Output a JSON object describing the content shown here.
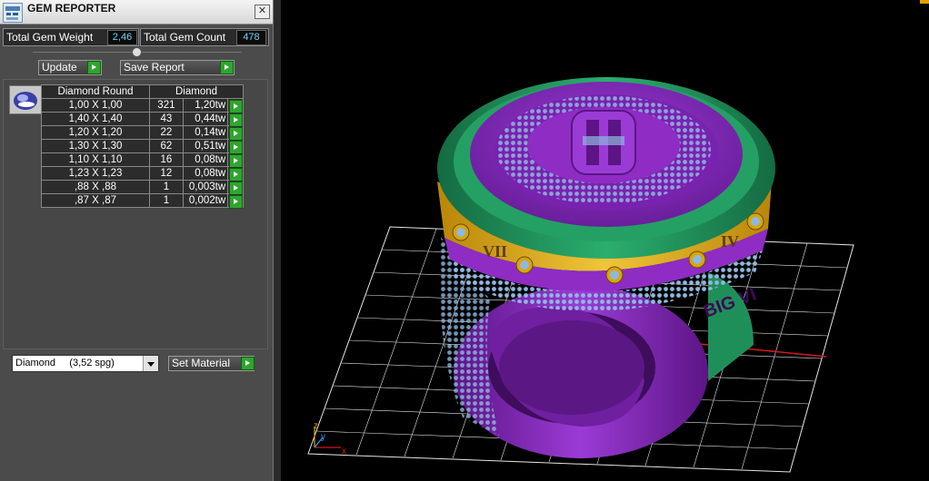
{
  "window": {
    "title": "GEM REPORTER",
    "close_glyph": "✕"
  },
  "stats": {
    "total_weight_label": "Total Gem Weight",
    "total_weight_value": "2,46",
    "total_count_label": "Total Gem Count",
    "total_count_value": "478"
  },
  "actions": {
    "update_label": "Update",
    "save_report_label": "Save Report"
  },
  "table": {
    "headers": [
      "Diamond Round",
      "Diamond"
    ],
    "rows": [
      {
        "size": "1,00 X 1,00",
        "count": "321",
        "weight": "1,20tw"
      },
      {
        "size": "1,40 X 1,40",
        "count": "43",
        "weight": "0,44tw"
      },
      {
        "size": "1,20 X 1,20",
        "count": "22",
        "weight": "0,14tw"
      },
      {
        "size": "1,30 X 1,30",
        "count": "62",
        "weight": "0,51tw"
      },
      {
        "size": "1,10 X 1,10",
        "count": "16",
        "weight": "0,08tw"
      },
      {
        "size": "1,23 X 1,23",
        "count": "12",
        "weight": "0,08tw"
      },
      {
        "size": ",88 X ,88",
        "count": "1",
        "weight": "0,003tw"
      },
      {
        "size": ",87 X ,87",
        "count": "1",
        "weight": "0,002tw"
      }
    ]
  },
  "material": {
    "selected": "Diamond     (3,52 spg)",
    "set_label": "Set Material"
  },
  "viewport": {
    "axis_labels": {
      "x": "x",
      "y": "y",
      "z": "z"
    },
    "ring_text": {
      "numeral_left": "VII",
      "numeral_right": "IV",
      "side_text": "BIG VI"
    },
    "colors": {
      "band": "#7a22b0",
      "top": "#8e2cc4",
      "green": "#1f8f5a",
      "gold": "#d9a50c",
      "gems": "#8fb8e0",
      "grid": "#ffffff"
    }
  },
  "icons": [
    "app-icon",
    "close-icon",
    "collapse-icon",
    "play-icon",
    "gem-icon",
    "chevron-down-icon"
  ]
}
